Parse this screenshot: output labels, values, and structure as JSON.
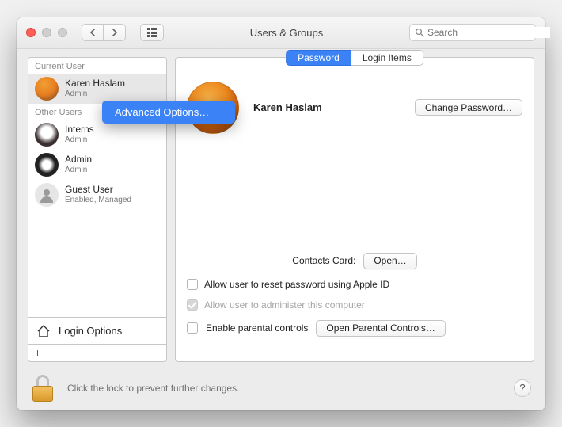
{
  "window": {
    "title": "Users & Groups"
  },
  "toolbar": {
    "search_placeholder": "Search"
  },
  "sidebar": {
    "current_label": "Current User",
    "other_label": "Other Users",
    "current": {
      "name": "Karen Haslam",
      "role": "Admin"
    },
    "others": [
      {
        "name": "Interns",
        "role": "Admin"
      },
      {
        "name": "Admin",
        "role": "Admin"
      },
      {
        "name": "Guest User",
        "role": "Enabled, Managed"
      }
    ],
    "login_options": "Login Options"
  },
  "context_menu": {
    "item": "Advanced Options…"
  },
  "tabs": {
    "password": "Password",
    "login_items": "Login Items"
  },
  "main": {
    "user_name": "Karen Haslam",
    "change_password": "Change Password…",
    "contacts_label": "Contacts Card:",
    "open": "Open…",
    "allow_reset": "Allow user to reset password using Apple ID",
    "allow_admin": "Allow user to administer this computer",
    "parental_label": "Enable parental controls",
    "open_parental": "Open Parental Controls…"
  },
  "footer": {
    "lock_text": "Click the lock to prevent further changes."
  }
}
